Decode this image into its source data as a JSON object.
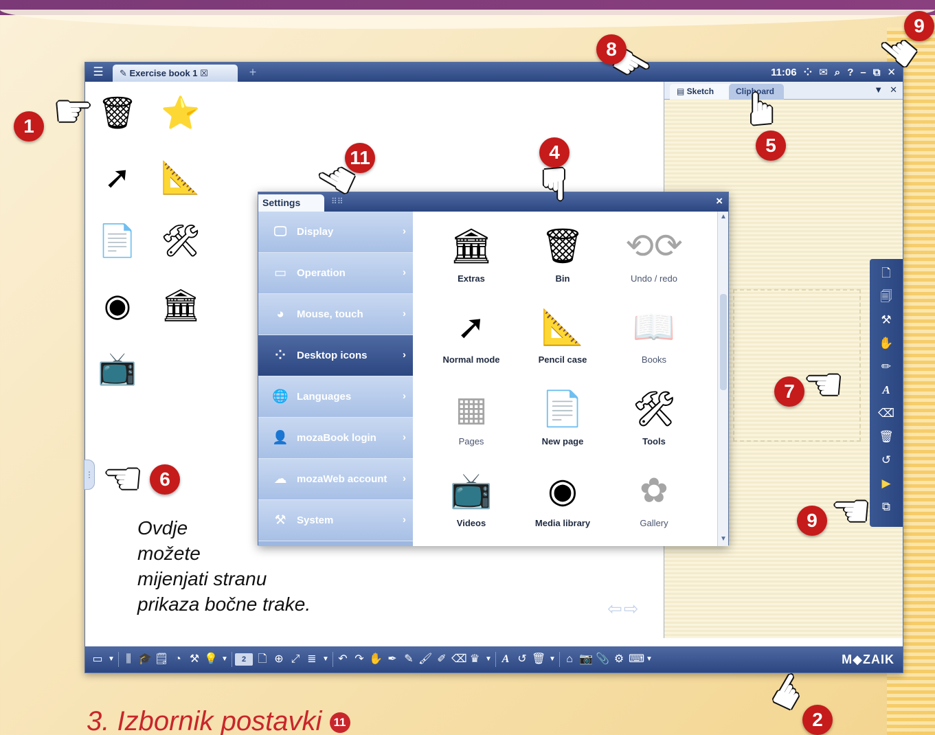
{
  "window": {
    "menu_icon": "hamburger-icon",
    "tab_label": "Exercise book 1",
    "tab_add": "+",
    "clock": "11:06",
    "accent_color": "#2b4680"
  },
  "sidepanel": {
    "tabs": [
      "Sketch",
      "Clipboard"
    ]
  },
  "settings": {
    "title": "Settings",
    "close": "×",
    "menu": [
      {
        "label": "Display",
        "icon": "monitor-icon"
      },
      {
        "label": "Operation",
        "icon": "window-icon"
      },
      {
        "label": "Mouse, touch",
        "icon": "mouse-icon"
      },
      {
        "label": "Desktop icons",
        "icon": "dots-icon",
        "active": true
      },
      {
        "label": "Languages",
        "icon": "globe-icon"
      },
      {
        "label": "mozaBook login",
        "icon": "user-icon"
      },
      {
        "label": "mozaWeb account",
        "icon": "cloud-user-icon"
      },
      {
        "label": "System",
        "icon": "tools-icon"
      }
    ],
    "grid": [
      {
        "label": "Extras",
        "icon": "museum-icon",
        "enabled": true
      },
      {
        "label": "Bin",
        "icon": "bin-icon",
        "enabled": true
      },
      {
        "label": "Undo / redo",
        "icon": "undo-redo-icon",
        "enabled": false
      },
      {
        "label": "Normal mode",
        "icon": "cursor-icon",
        "enabled": true
      },
      {
        "label": "Pencil case",
        "icon": "pencil-case-icon",
        "enabled": true
      },
      {
        "label": "Books",
        "icon": "book-icon",
        "enabled": false
      },
      {
        "label": "Pages",
        "icon": "pages-icon",
        "enabled": false
      },
      {
        "label": "New page",
        "icon": "new-page-icon",
        "enabled": true
      },
      {
        "label": "Tools",
        "icon": "tools-icon",
        "enabled": true
      },
      {
        "label": "Videos",
        "icon": "tv-icon",
        "enabled": true
      },
      {
        "label": "Media library",
        "icon": "media-icon",
        "enabled": true
      },
      {
        "label": "Gallery",
        "icon": "flower-icon",
        "enabled": false
      }
    ]
  },
  "bottombar": {
    "page_number": "2",
    "logo": "M◆ZAIK"
  },
  "annotations": {
    "badges": [
      "1",
      "2",
      "4",
      "5",
      "6",
      "7",
      "8",
      "9",
      "9",
      "11"
    ],
    "caption": [
      "Ovdje",
      "možete",
      "mijenjati stranu",
      "prikaza bočne trake."
    ],
    "heading": "3. Izbornik postavki",
    "heading_badge": "11",
    "badge_color": "#c51b1b"
  }
}
